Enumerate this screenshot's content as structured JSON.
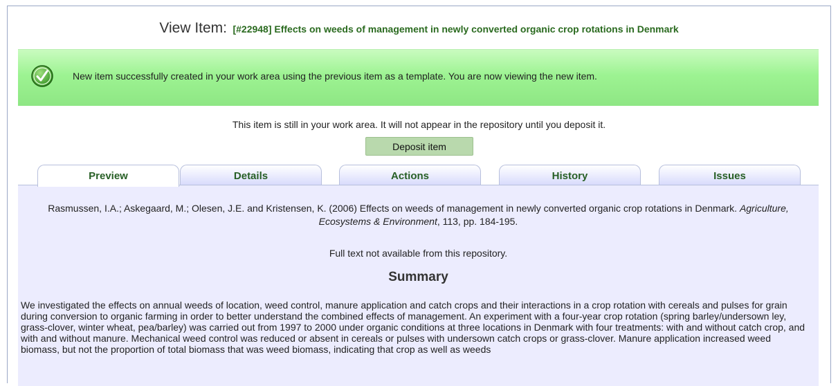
{
  "header": {
    "label": "View Item:",
    "item_title": "[#22948] Effects on weeds of management in newly converted organic crop rotations in Denmark"
  },
  "notice": {
    "icon": "check-circle-icon",
    "message": "New item successfully created in your work area using the previous item as a template. You are now viewing the new item."
  },
  "workarea": {
    "message": "This item is still in your work area. It will not appear in the repository until you deposit it.",
    "deposit_label": "Deposit item"
  },
  "tabs": [
    {
      "label": "Preview",
      "active": true
    },
    {
      "label": "Details",
      "active": false
    },
    {
      "label": "Actions",
      "active": false
    },
    {
      "label": "History",
      "active": false
    },
    {
      "label": "Issues",
      "active": false
    }
  ],
  "citation": {
    "authors_and_title": "Rasmussen, I.A.; Askegaard, M.; Olesen, J.E. and Kristensen, K. (2006) Effects on weeds of management in newly converted organic crop rotations in Denmark.",
    "journal": "Agriculture, Ecosystems & Environment",
    "volume_pages": ", 113, pp. 184-195."
  },
  "fulltext_note": "Full text not available from this repository.",
  "summary": {
    "heading": "Summary",
    "text": "We investigated the effects on annual weeds of location, weed control, manure application and catch crops and their interactions in a crop rotation with cereals and pulses for grain during conversion to organic farming in order to better understand the combined effects of management. An experiment with a four-year crop rotation (spring barley/undersown ley, grass-clover, winter wheat, pea/barley) was carried out from 1997 to 2000 under organic conditions at three locations in Denmark with four treatments: with and without catch crop, and with and without manure. Mechanical weed control was reduced or absent in cereals or pulses with undersown catch crops or grass-clover. Manure application increased weed biomass, but not the proportion of total biomass that was weed biomass, indicating that crop as well as weeds"
  },
  "colors": {
    "tab_text": "#275f25",
    "title_text": "#2a6a1f",
    "panel_bg": "#ececfe",
    "success_bg": "#9df392",
    "deposit_bg": "#b9d9ad"
  }
}
